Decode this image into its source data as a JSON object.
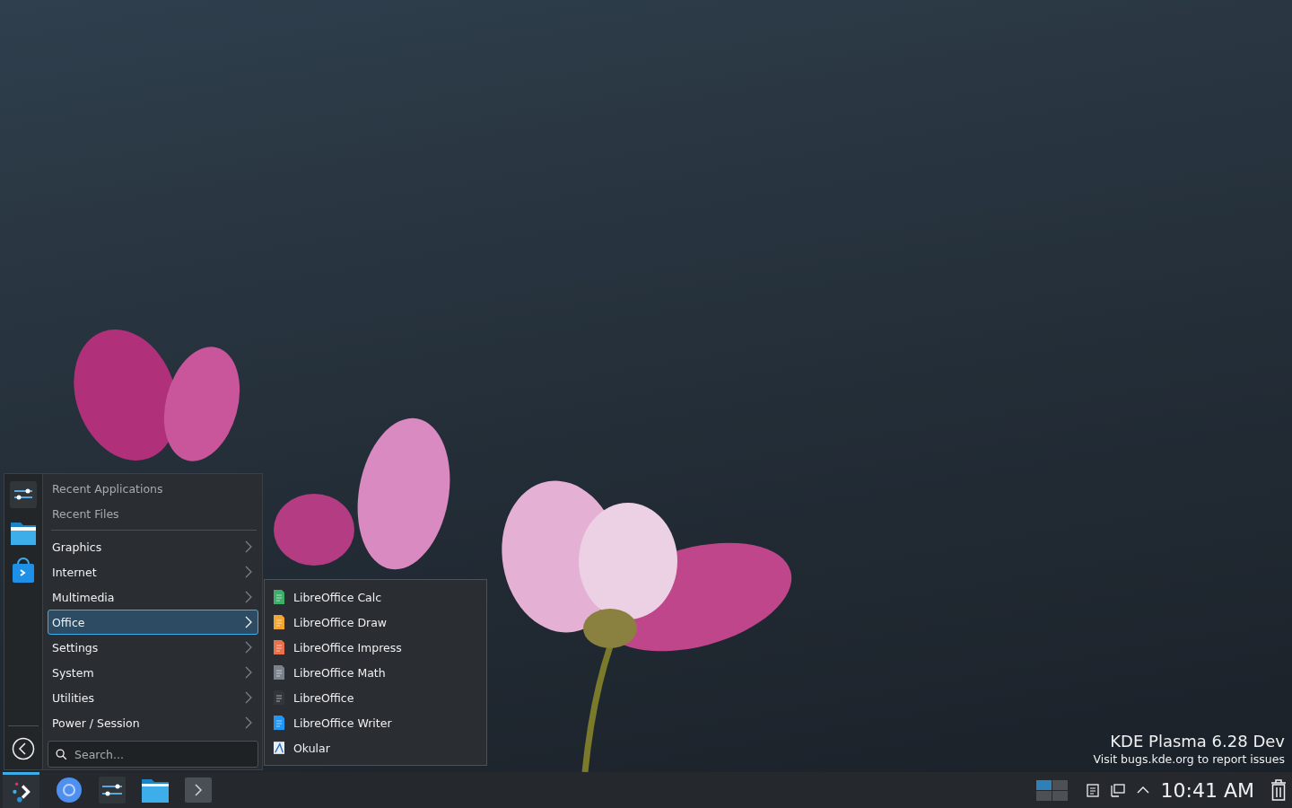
{
  "launcher": {
    "menu": [
      {
        "label": "Recent Applications",
        "kind": "recent",
        "selected": false
      },
      {
        "label": "Recent Files",
        "kind": "recent",
        "selected": false
      },
      {
        "label": "Graphics",
        "kind": "category",
        "selected": false
      },
      {
        "label": "Internet",
        "kind": "category",
        "selected": false
      },
      {
        "label": "Multimedia",
        "kind": "category",
        "selected": false
      },
      {
        "label": "Office",
        "kind": "category",
        "selected": true
      },
      {
        "label": "Settings",
        "kind": "category",
        "selected": false
      },
      {
        "label": "System",
        "kind": "category",
        "selected": false
      },
      {
        "label": "Utilities",
        "kind": "category",
        "selected": false
      },
      {
        "label": "Power / Session",
        "kind": "category",
        "selected": false
      }
    ],
    "search": {
      "placeholder": "Search..."
    }
  },
  "submenu": {
    "items": [
      {
        "label": "LibreOffice Calc",
        "kind": "document",
        "color": "#3fae6a"
      },
      {
        "label": "LibreOffice Draw",
        "kind": "document",
        "color": "#f2a531"
      },
      {
        "label": "LibreOffice Impress",
        "kind": "document",
        "color": "#e8704a"
      },
      {
        "label": "LibreOffice Math",
        "kind": "document",
        "color": "#7a838c"
      },
      {
        "label": "LibreOffice",
        "kind": "document",
        "color": "#33373c"
      },
      {
        "label": "LibreOffice Writer",
        "kind": "document",
        "color": "#2196f3"
      },
      {
        "label": "Okular",
        "kind": "viewer"
      }
    ]
  },
  "watermark": {
    "title": "KDE Plasma 6.28 Dev",
    "subtitle": "Visit bugs.kde.org to report issues"
  },
  "taskbar": {
    "launcher_active": true,
    "pager": [
      {
        "selected": true
      },
      {
        "selected": false
      },
      {
        "selected": false
      },
      {
        "selected": false
      }
    ],
    "clock": "10:41 AM"
  }
}
